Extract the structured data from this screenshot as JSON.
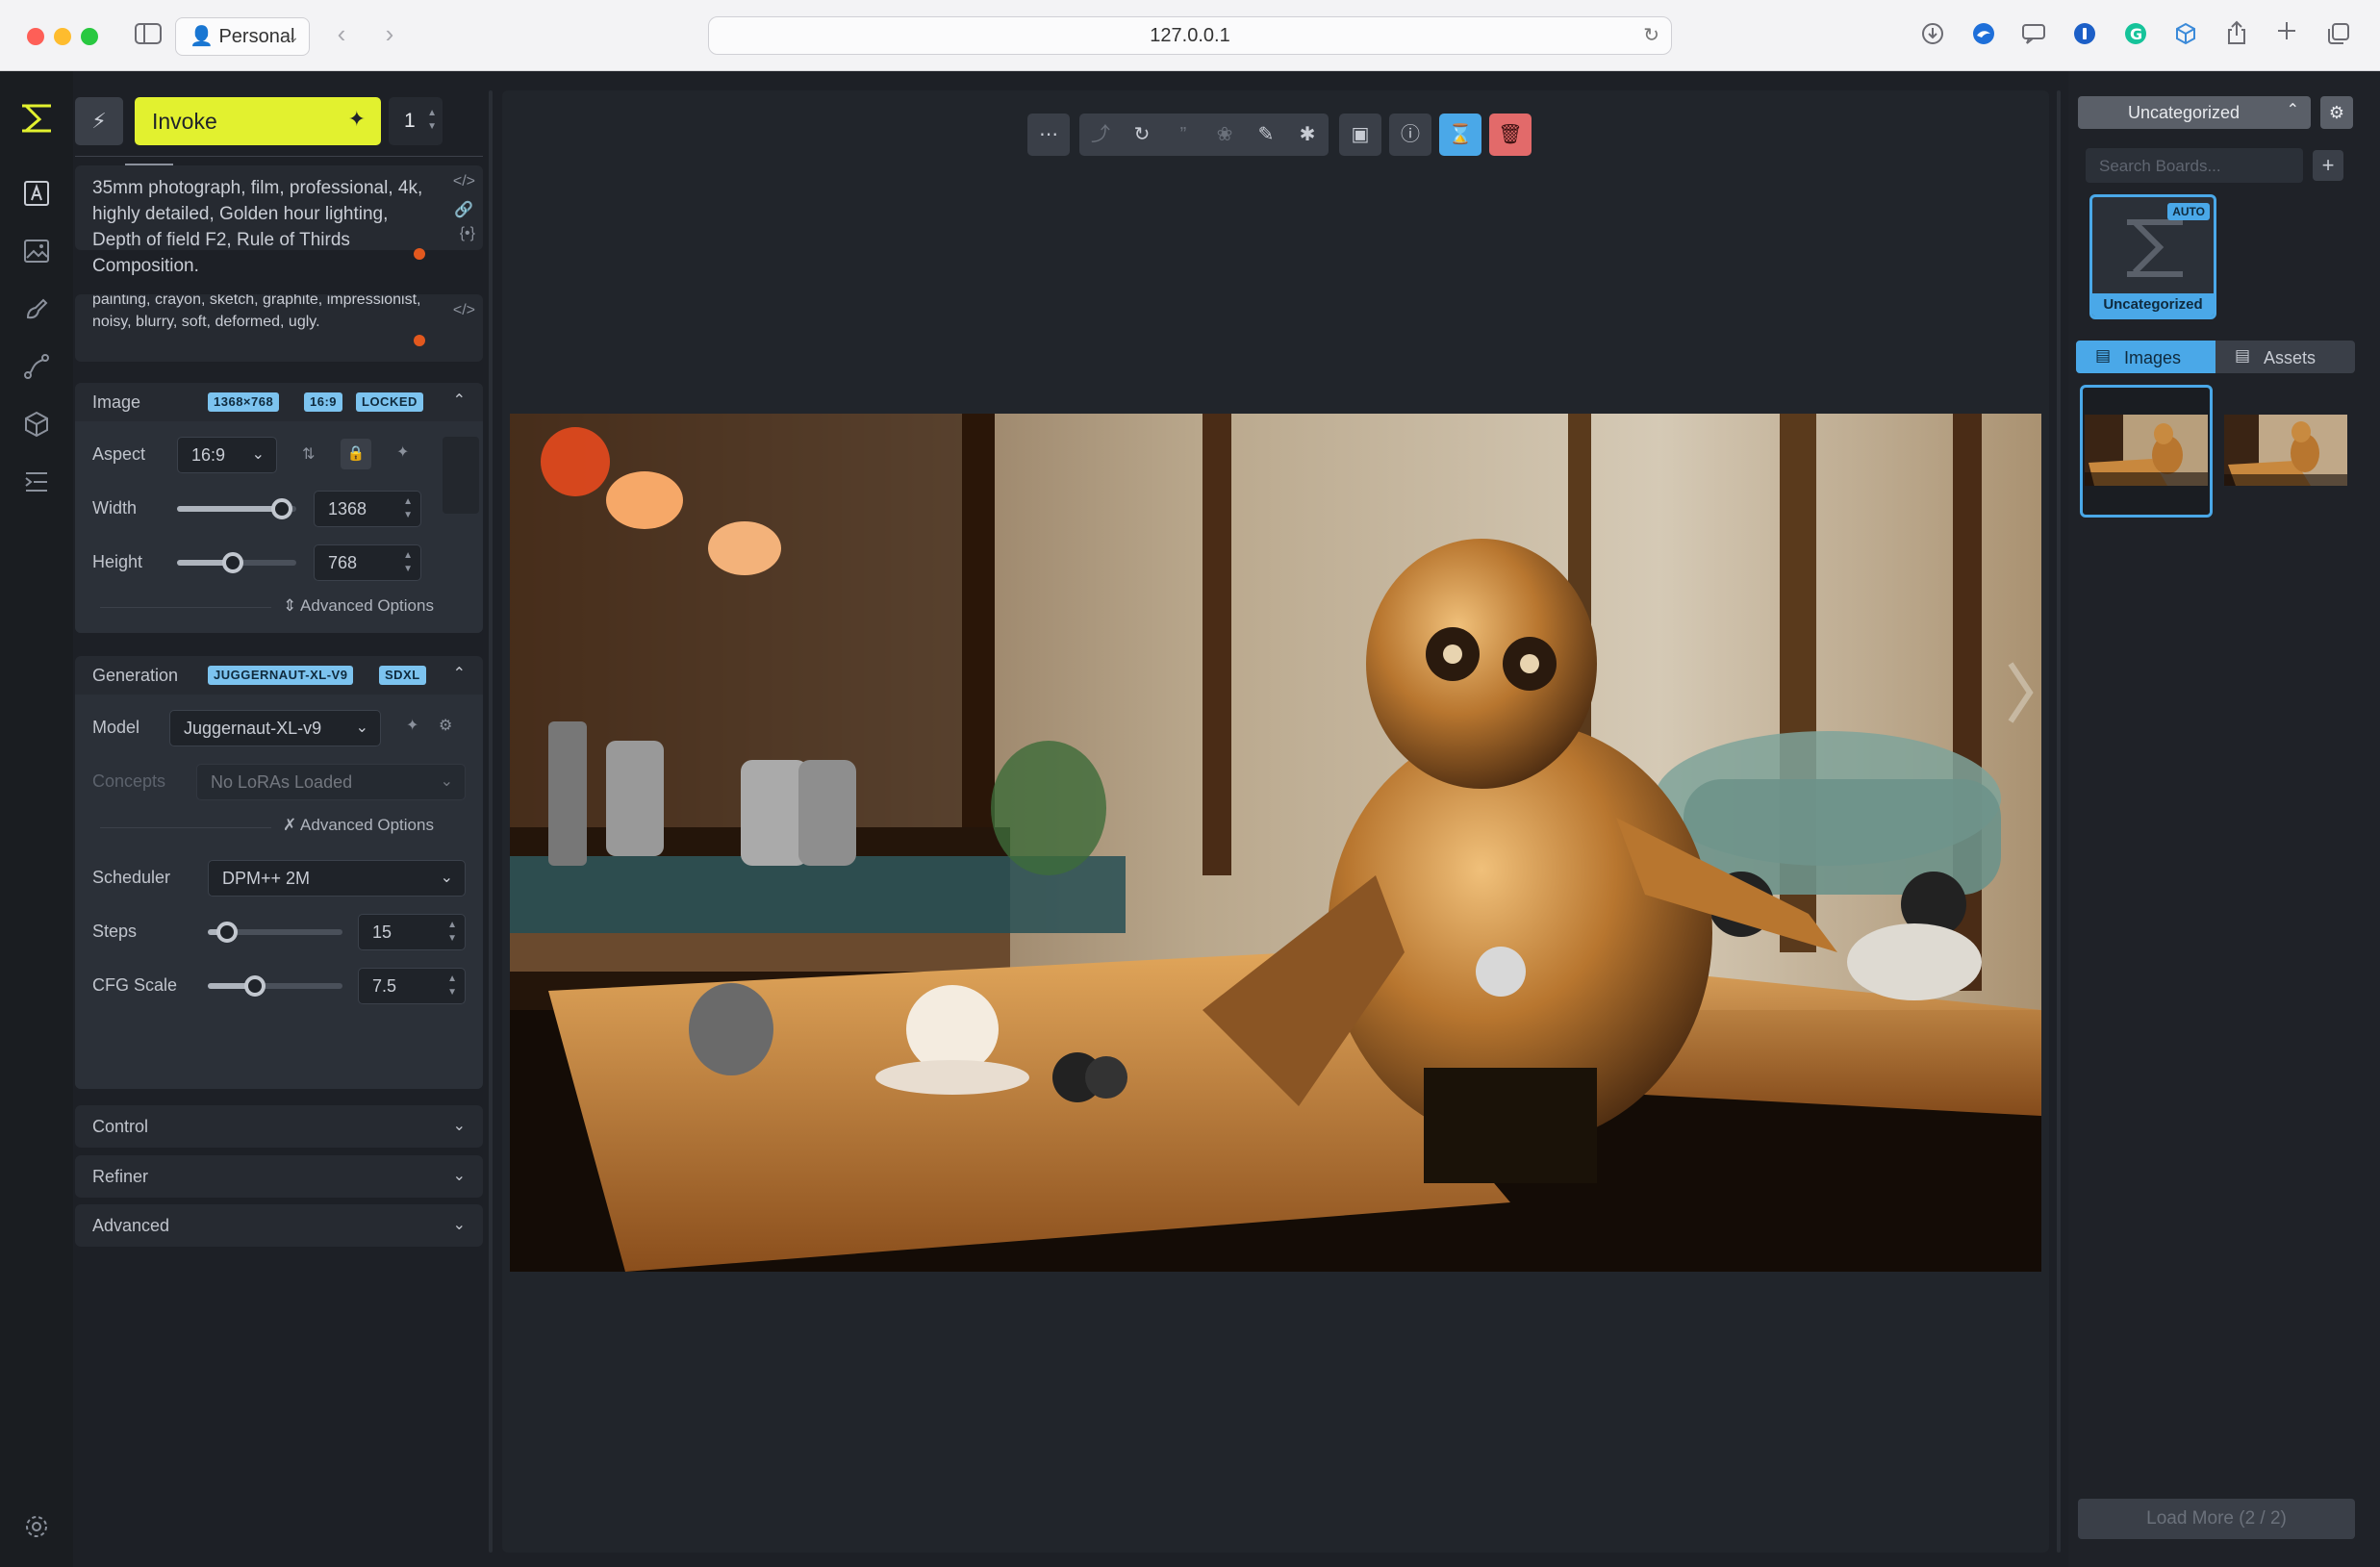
{
  "browser": {
    "profile": "Personal",
    "url": "127.0.0.1"
  },
  "header": {
    "invoke_label": "Invoke",
    "iterations": "1"
  },
  "prompts": {
    "positive": "35mm photograph, film, professional, 4k, highly detailed, Golden hour lighting, Depth of field F2, Rule of Thirds Composition.",
    "negative": "painting, crayon, sketch, graphite, impressionist, noisy, blurry, soft, deformed, ugly."
  },
  "image_section": {
    "title": "Image",
    "badges": [
      "1368×768",
      "16:9",
      "LOCKED"
    ],
    "aspect_label": "Aspect",
    "aspect_value": "16:9",
    "width_label": "Width",
    "width_value": "1368",
    "height_label": "Height",
    "height_value": "768",
    "advanced_label": "Advanced Options"
  },
  "generation_section": {
    "title": "Generation",
    "badges": [
      "JUGGERNAUT-XL-V9",
      "SDXL"
    ],
    "model_label": "Model",
    "model_value": "Juggernaut-XL-v9",
    "concepts_label": "Concepts",
    "concepts_placeholder": "No LoRAs Loaded",
    "advanced_label": "Advanced Options",
    "scheduler_label": "Scheduler",
    "scheduler_value": "DPM++ 2M",
    "steps_label": "Steps",
    "steps_value": "15",
    "cfg_label": "CFG Scale",
    "cfg_value": "7.5"
  },
  "sliders": {
    "width_fraction": 0.88,
    "height_fraction": 0.47,
    "steps_fraction": 0.14,
    "cfg_fraction": 0.35
  },
  "collapsed_sections": [
    "Control",
    "Refiner",
    "Advanced"
  ],
  "gallery": {
    "board_select": "Uncategorized",
    "search_placeholder": "Search Boards...",
    "board_name": "Uncategorized",
    "board_badge": "AUTO",
    "tab_images": "Images",
    "tab_assets": "Assets",
    "load_more": "Load More (2 / 2)"
  },
  "colors": {
    "accent_yellow": "#e2f12f",
    "badge_blue": "#7cc3ef",
    "active_blue": "#4aa8e8",
    "delete_red": "#e26a6a"
  }
}
